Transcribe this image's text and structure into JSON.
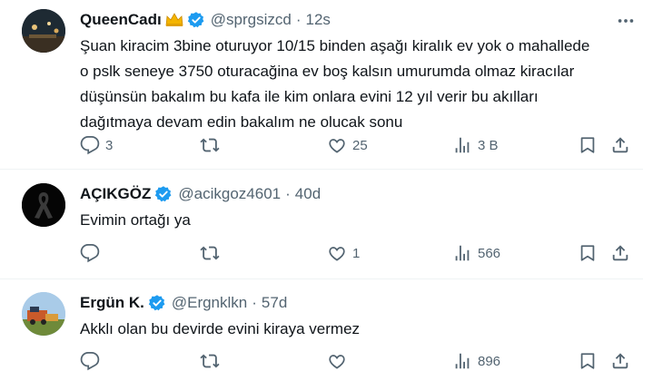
{
  "tweets": [
    {
      "name": "QueenCadı",
      "handle": "@sprgsizcd",
      "time": "12s",
      "lines": [
        "Şuan kiracim 3bine oturuyor 10/15 binden aşağı kiralık ev yok o mahallede",
        "o pslk seneye 3750 oturacağina  ev boş kalsın umurumda olmaz kiracılar",
        "düşünsün  bakalım bu kafa ile kim onlara evini 12 yıl verir bu akılları",
        "dağıtmaya devam edin bakalım ne olucak sonu"
      ],
      "replies": "3",
      "retweets": "",
      "likes": "25",
      "views": "3 B"
    },
    {
      "name": "AÇIKGÖZ",
      "handle": "@acikgoz4601",
      "time": "40d",
      "lines": [
        "Evimin ortağı ya"
      ],
      "replies": "",
      "retweets": "",
      "likes": "1",
      "views": "566"
    },
    {
      "name": "Ergün K.",
      "handle": "@Ergnklkn",
      "time": "57d",
      "lines": [
        "Akklı olan bu devirde evini kiraya vermez"
      ],
      "replies": "",
      "retweets": "",
      "likes": "",
      "views": "896"
    }
  ],
  "colors": {
    "text": "#0f1419",
    "secondary": "#536471",
    "verified": "#1d9bf0",
    "divider": "#eff3f4"
  },
  "icons": [
    "reply-icon",
    "retweet-icon",
    "like-icon",
    "views-icon",
    "bookmark-icon",
    "share-icon",
    "more-icon",
    "verified-icon",
    "crown-icon"
  ]
}
